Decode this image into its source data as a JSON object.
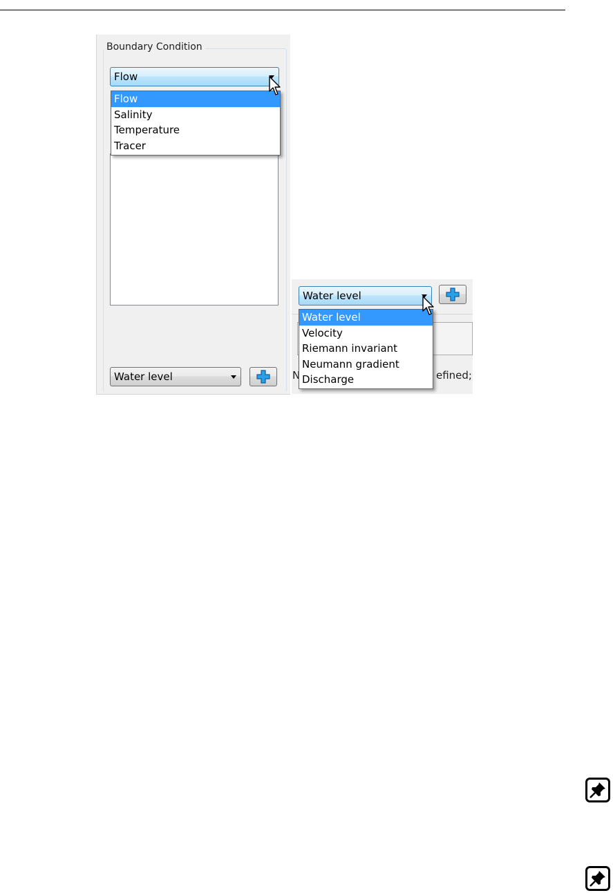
{
  "boundary_condition": {
    "group_title": "Boundary Condition",
    "category_combo": {
      "selected": "Flow",
      "options": [
        "Flow",
        "Salinity",
        "Temperature",
        "Tracer"
      ]
    },
    "type_combo_collapsed": {
      "selected": "Water level"
    },
    "type_combo_open": {
      "selected": "Water level",
      "options": [
        "Water level",
        "Velocity",
        "Riemann invariant",
        "Neumann gradient",
        "Discharge"
      ]
    },
    "status_left": "N",
    "status_right": "efined;"
  },
  "icons": {
    "add": "plus-icon",
    "pointer": "mouse-pointer-icon",
    "note": "pin-note-icon"
  },
  "colors": {
    "accent": "#3399ff",
    "plus": "#2aa0e6"
  }
}
